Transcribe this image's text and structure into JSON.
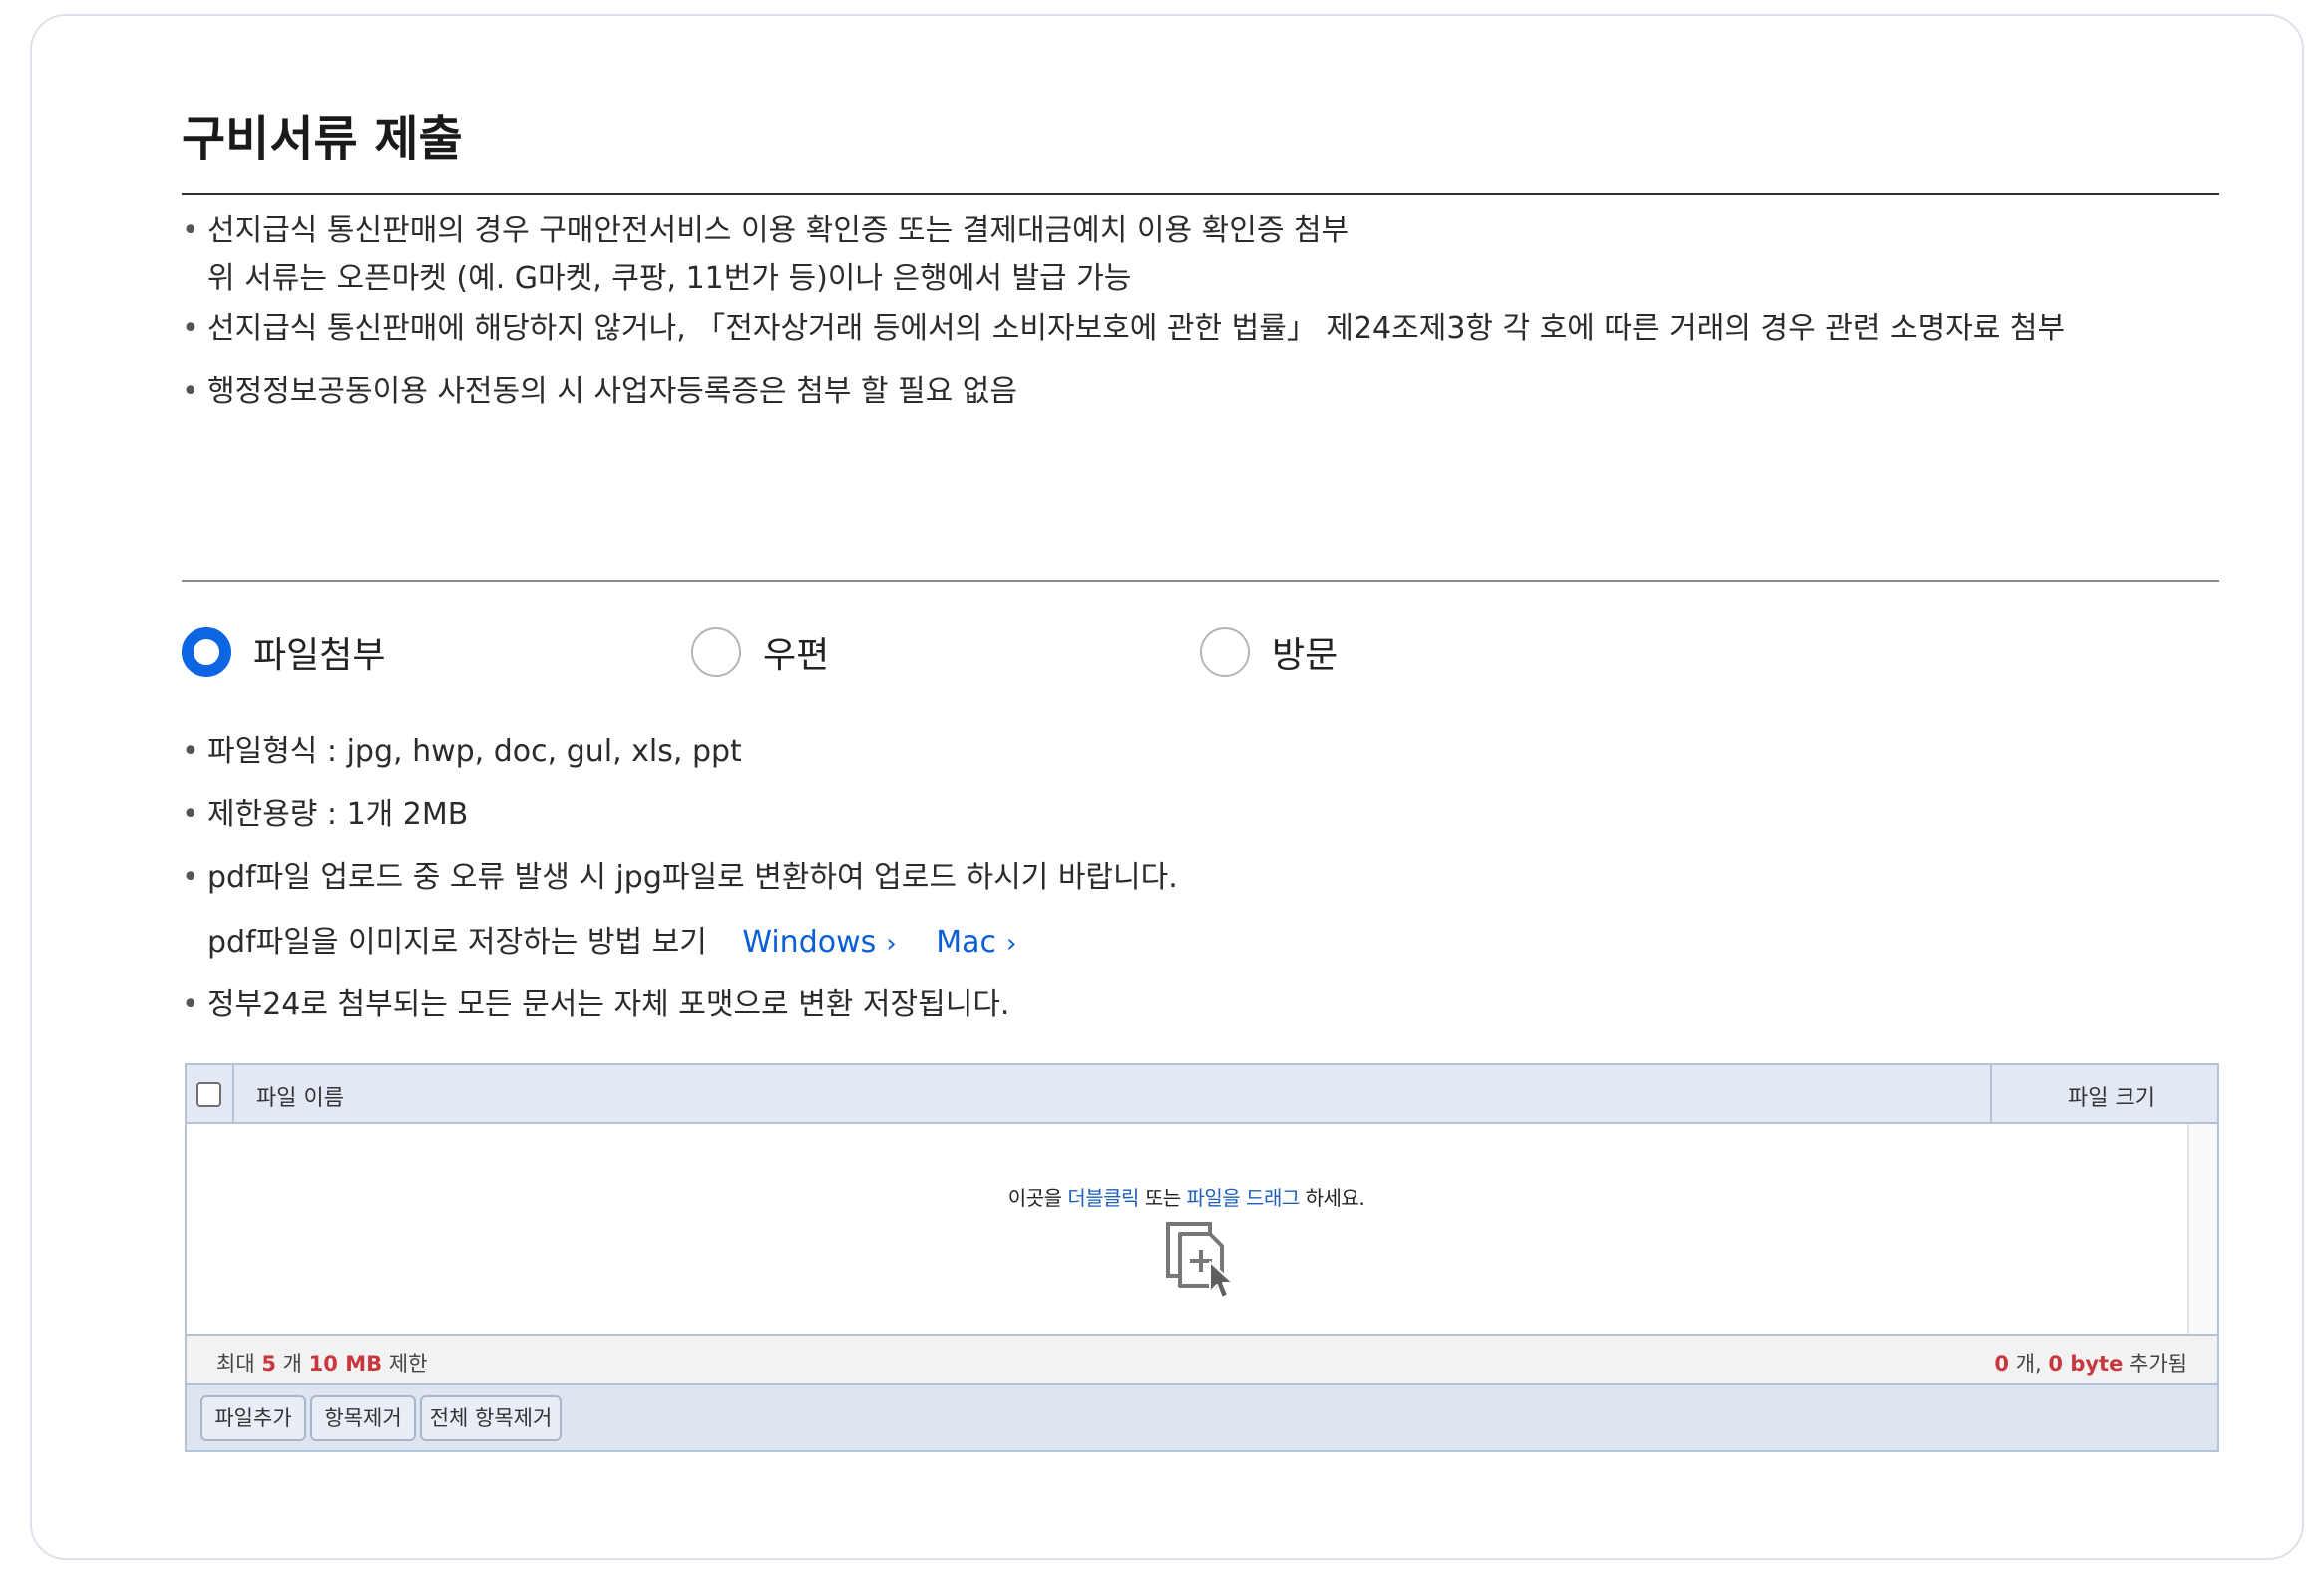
{
  "page": {
    "title": "구비서류 제출"
  },
  "notice": {
    "items": [
      {
        "line1": "선지급식 통신판매의 경우 구매안전서비스 이용 확인증 또는 결제대금예치 이용 확인증 첨부",
        "line2": "위 서류는 오픈마켓 (예. G마켓, 쿠팡, 11번가 등)이나 은행에서 발급 가능"
      },
      {
        "line1": "선지급식 통신판매에 해당하지 않거나, 「전자상거래 등에서의 소비자보호에 관한 법률」 제24조제3항 각 호에 따른 거래의 경우 관련 소명자료 첨부"
      },
      {
        "line1": "행정정보공동이용 사전동의 시 사업자등록증은 첨부 할 필요 없음"
      }
    ],
    "bullet": "•"
  },
  "submit_method": {
    "options": [
      {
        "label": "파일첨부",
        "checked": true
      },
      {
        "label": "우편",
        "checked": false
      },
      {
        "label": "방문",
        "checked": false
      }
    ]
  },
  "file_info": {
    "format": "파일형식 : jpg, hwp, doc, gul, xls, ppt",
    "limit": "제한용량 : 1개 2MB",
    "pdf_notice": "pdf파일 업로드 중 오류 발생 시 jpg파일로 변환하여 업로드 하시기 바랍니다.",
    "pdf_guide": "pdf파일을 이미지로 저장하는 방법 보기",
    "link_windows": "Windows",
    "link_mac": "Mac",
    "chevron": "›",
    "format_notice": "정부24로 첨부되는 모든 문서는 자체 포맷으로 변환 저장됩니다."
  },
  "uploader": {
    "header_name": "파일 이름",
    "header_size": "파일 크기",
    "drop_text_1": "이곳을",
    "drop_text_hl1": "더블클릭",
    "drop_text_2": "또는",
    "drop_text_hl2": "파일을 드래그",
    "drop_text_3": "하세요.",
    "status_left_prefix": "최대",
    "max_count": "5",
    "count_unit": "개",
    "max_size": "10 MB",
    "status_left_suffix": "제한",
    "added_count": "0",
    "added_count_unit": "개,",
    "added_size": "0 byte",
    "added_suffix": "추가됨",
    "buttons": {
      "add": "파일추가",
      "remove": "항목제거",
      "remove_all": "전체 항목제거"
    }
  },
  "colors": {
    "accent": "#0c66e4",
    "link": "#0a5ed8",
    "highlight": "#c8373d",
    "uploader_header": "#e3e9f4"
  },
  "icons": {
    "radio_checked": "radio-checked-icon",
    "radio_unchecked": "radio-unchecked-icon",
    "file_add": "file-add-cursor-icon",
    "chevron": "chevron-right-icon"
  }
}
